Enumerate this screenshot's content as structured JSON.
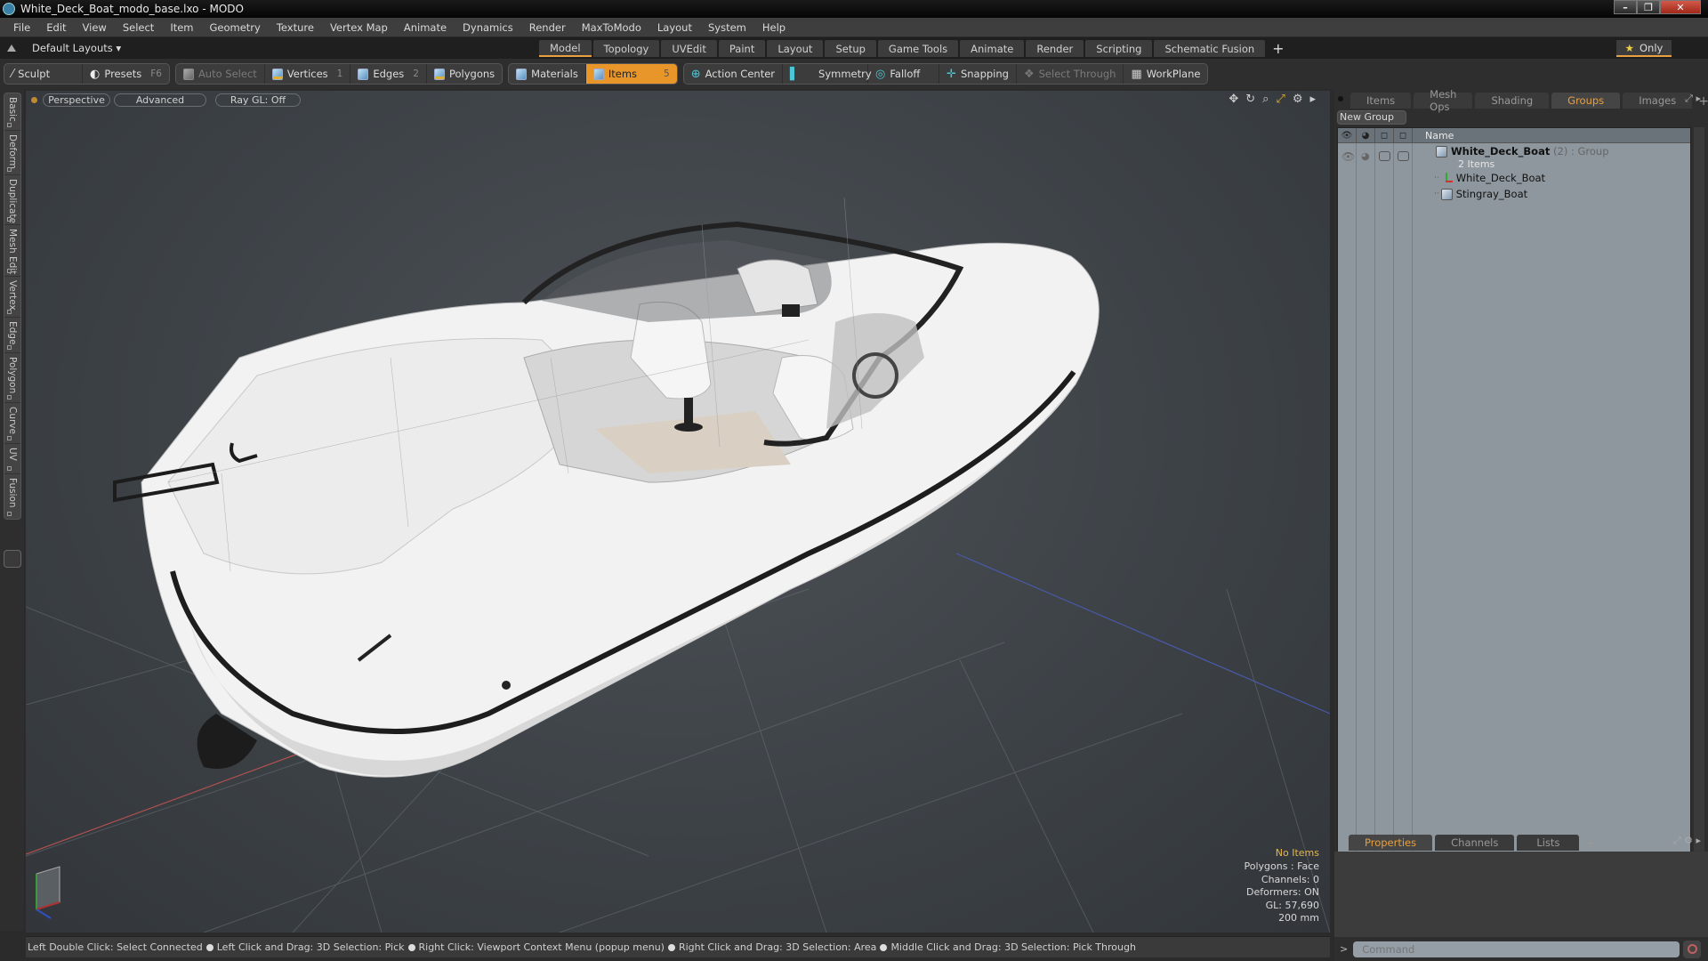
{
  "window": {
    "title": "White_Deck_Boat_modo_base.lxo - MODO",
    "controls": {
      "minimize": "–",
      "restore": "❐",
      "close": "✕"
    }
  },
  "menu": [
    "File",
    "Edit",
    "View",
    "Select",
    "Item",
    "Geometry",
    "Texture",
    "Vertex Map",
    "Animate",
    "Dynamics",
    "Render",
    "MaxToModo",
    "Layout",
    "System",
    "Help"
  ],
  "layoutbar": {
    "layouts_label": "Default Layouts ▾",
    "mode_tabs": [
      "Model",
      "Topology",
      "UVEdit",
      "Paint",
      "Layout",
      "Setup",
      "Game Tools",
      "Animate",
      "Render",
      "Scripting",
      "Schematic Fusion"
    ],
    "active_mode": "Model",
    "add_tab": "+",
    "only_label": "Only",
    "only_icon": "★",
    "gear_icon": "⚙"
  },
  "toolbar": {
    "sculpt": "Sculpt",
    "presets": "Presets",
    "presets_key": "F6",
    "auto_select": "Auto Select",
    "vertices": "Vertices",
    "vertices_key": "1",
    "edges": "Edges",
    "edges_key": "2",
    "polygons": "Polygons",
    "materials": "Materials",
    "items": "Items",
    "items_key": "5",
    "action_center": "Action Center",
    "symmetry": "Symmetry",
    "falloff": "Falloff",
    "snapping": "Snapping",
    "select_through": "Select Through",
    "workplane": "WorkPlane"
  },
  "left_tabs": [
    "Basic",
    "Deform",
    "Duplicate",
    "Mesh Edit",
    "Vertex",
    "Edge",
    "Polygon",
    "Curve",
    "UV",
    "Fusion"
  ],
  "viewport": {
    "view_mode": "Perspective",
    "shading": "Advanced",
    "raygl": "Ray GL: Off",
    "tool_icons": [
      "✥",
      "↻",
      "⌕",
      "⤢",
      "⚙",
      "▸"
    ],
    "info": {
      "selection": "No Items",
      "polygons": "Polygons : Face",
      "channels": "Channels: 0",
      "deformers": "Deformers: ON",
      "gl": "GL: 57,690",
      "scale": "200 mm"
    }
  },
  "statusbar": {
    "hints": [
      "Left Double Click: Select Connected",
      "Left Click and Drag: 3D Selection: Pick",
      "Right Click: Viewport Context Menu (popup menu)",
      "Right Click and Drag: 3D Selection: Area",
      "Middle Click and Drag: 3D Selection: Pick Through"
    ]
  },
  "right_panel": {
    "tabs": [
      "Items",
      "Mesh Ops",
      "Shading",
      "Groups",
      "Images"
    ],
    "active_tab": "Groups",
    "add_tab": "+",
    "new_group": "New Group",
    "list_header": {
      "name": "Name"
    },
    "group": {
      "name": "White_Deck_Boat",
      "count": "(2)",
      "type": ": Group",
      "sub": "2 Items",
      "children": [
        {
          "name": "White_Deck_Boat",
          "icon": "locator-icon"
        },
        {
          "name": "Stingray_Boat",
          "icon": "mesh-icon"
        }
      ]
    },
    "bottom_tabs": [
      "Properties",
      "Channels",
      "Lists"
    ],
    "bottom_active": "Properties",
    "command_placeholder": "Command",
    "command_prompt": ">"
  }
}
